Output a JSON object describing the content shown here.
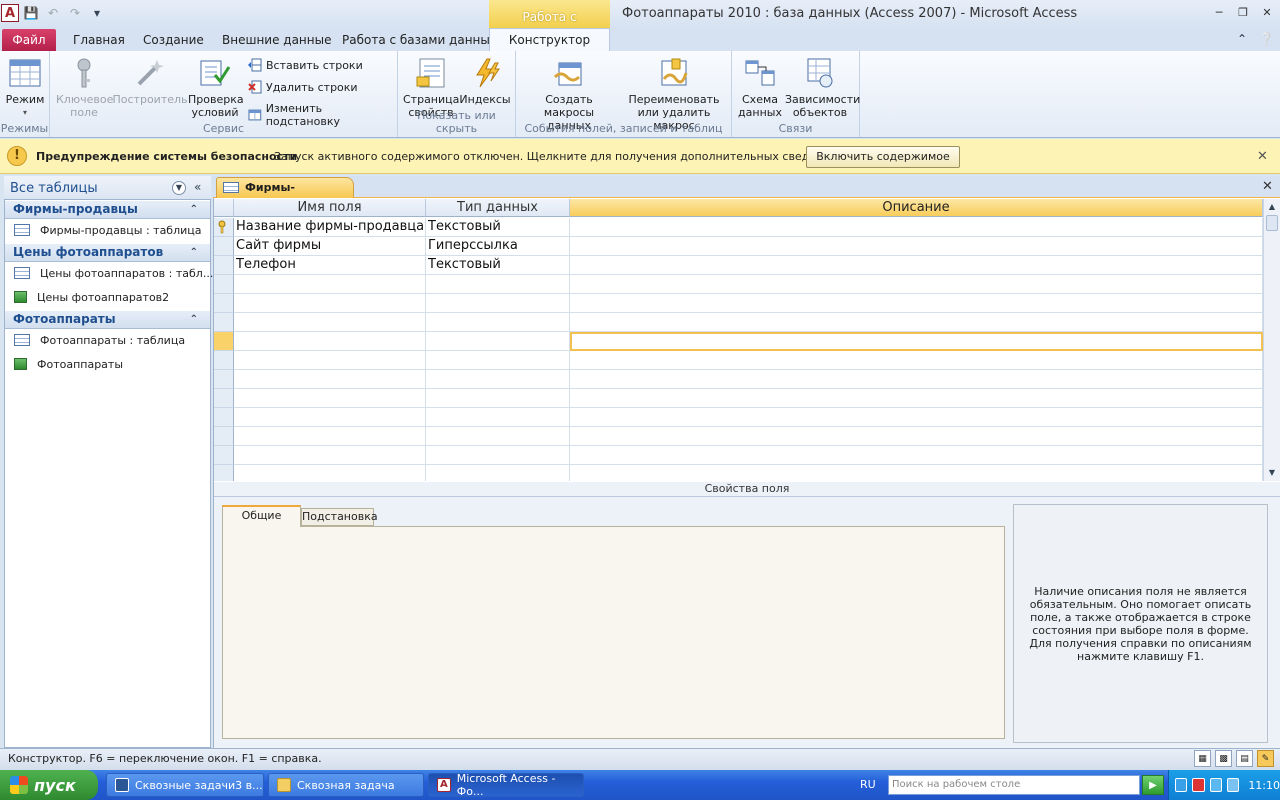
{
  "app": {
    "title": "Фотоаппараты 2010 : база данных (Access 2007)  -  Microsoft Access",
    "context_group": "Работа с таблицами"
  },
  "ribbon_tabs": {
    "file": "Файл",
    "home": "Главная",
    "create": "Создание",
    "external": "Внешние данные",
    "database": "Работа с базами данных",
    "design": "Конструктор"
  },
  "ribbon": {
    "view": {
      "label": "Режим",
      "group": "Режимы"
    },
    "tools": {
      "primary_key": "Ключевое поле",
      "builder": "Построитель",
      "test_rules": "Проверка условий",
      "insert_rows": "Вставить строки",
      "delete_rows": "Удалить строки",
      "modify_lookups": "Изменить подстановку",
      "group": "Сервис"
    },
    "showhide": {
      "property_sheet": "Страница свойств",
      "indexes": "Индексы",
      "group": "Показать или скрыть"
    },
    "events": {
      "create_macros": "Создать макросы данных",
      "rename_macro": "Переименовать или удалить макрос",
      "group": "События полей, записей и таблиц"
    },
    "relationships": {
      "relationships": "Схема данных",
      "dependencies": "Зависимости объектов",
      "group": "Связи"
    }
  },
  "security": {
    "title": "Предупреждение системы безопасности",
    "message": "Запуск активного содержимого отключен. Щелкните для получения дополнительных сведений.",
    "button": "Включить содержимое"
  },
  "nav": {
    "title": "Все таблицы",
    "sections": [
      {
        "name": "Фирмы-продавцы",
        "items": [
          "Фирмы-продавцы : таблица"
        ]
      },
      {
        "name": "Цены фотоаппаратов",
        "items": [
          "Цены фотоаппаратов : табл...",
          "Цены фотоаппаратов2"
        ]
      },
      {
        "name": "Фотоаппараты",
        "items": [
          "Фотоаппараты : таблица",
          "Фотоаппараты"
        ]
      }
    ]
  },
  "document": {
    "tab": "Фирмы-продавцы"
  },
  "grid": {
    "headers": [
      "Имя поля",
      "Тип данных",
      "Описание"
    ],
    "rows": [
      [
        "Название фирмы-продавца",
        "Текстовый",
        ""
      ],
      [
        "Сайт фирмы",
        "Гиперссылка",
        ""
      ],
      [
        "Телефон",
        "Текстовый",
        ""
      ]
    ]
  },
  "properties": {
    "label": "Свойства поля",
    "tab_general": "Общие",
    "tab_lookup": "Подстановка",
    "help": "Наличие описания поля не является обязательным. Оно помогает описать поле, а также отображается в строке состояния при выборе поля в форме. Для получения справки по описаниям нажмите клавишу F1."
  },
  "status": "Конструктор.  F6 = переключение окон.  F1 = справка.",
  "taskbar": {
    "start": "пуск",
    "tasks": [
      "Сквозные задачи3 в...",
      "Сквозная задача",
      "Microsoft Access - Фо..."
    ],
    "lang": "RU",
    "search_placeholder": "Поиск на рабочем столе",
    "clock": "11:10"
  }
}
